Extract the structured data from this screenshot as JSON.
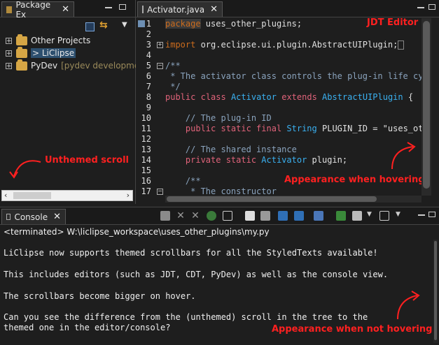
{
  "package_explorer": {
    "tab_label": "Package Ex",
    "tree": [
      {
        "label": "Other Projects",
        "suffix": ""
      },
      {
        "label": "> LiClipse",
        "suffix": ""
      },
      {
        "label": "PyDev",
        "suffix": "[pydev development]"
      }
    ],
    "annotation": "Unthemed scroll"
  },
  "editor": {
    "tab_label": "Activator.java",
    "annotation_top": "JDT Editor",
    "annotation_hover": "Appearance when hovering",
    "line_numbers": [
      "1",
      "2",
      "3",
      "4",
      "5",
      "6",
      "7",
      "8",
      "9",
      "10",
      "11",
      "12",
      "13",
      "14",
      "15",
      "16",
      "17"
    ],
    "lines": {
      "l1_kw": "package",
      "l1_rest": " uses_other_plugins;",
      "l3_kw": "import",
      "l3_rest": " org.eclipse.ui.plugin.AbstractUIPlugin;",
      "l6": "/**",
      "l7": " * The activator class controls the plug-in life cyc",
      "l8": " */",
      "l9_kw1": "public",
      "l9_kw2": "class",
      "l9_cls": "Activator",
      "l9_kw3": "extends",
      "l9_cls2": "AbstractUIPlugin",
      "l9_rest": " {",
      "l11": "    // The plug-in ID",
      "l12_kw": "    public static final",
      "l12_cls": "String",
      "l12_rest": " PLUGIN_ID = \"uses_oth",
      "l14": "    // The shared instance",
      "l15_kw": "    private static",
      "l15_cls": "Activator",
      "l15_rest": " plugin;",
      "l17": "    /**",
      "l18": "     * The constructor"
    }
  },
  "console": {
    "tab_label": "Console",
    "status": "<terminated> W:\\liclipse_workspace\\uses_other_plugins\\my.py",
    "lines": [
      "LiClipse now supports themed scrollbars for all the StyledTexts available!",
      "This includes editors (such as JDT, CDT, PyDev) as well as the console view.",
      "The scrollbars become bigger on hover.",
      "Can you see the difference from the (unthemed) scroll in the tree to the",
      "themed one in the editor/console?"
    ],
    "annotation": "Appearance when not hovering"
  },
  "colors": {
    "annotation": "#ff2020",
    "keyword": "#cc6c1d",
    "class": "#3ab0f0",
    "comment": "#8aa3bd"
  }
}
